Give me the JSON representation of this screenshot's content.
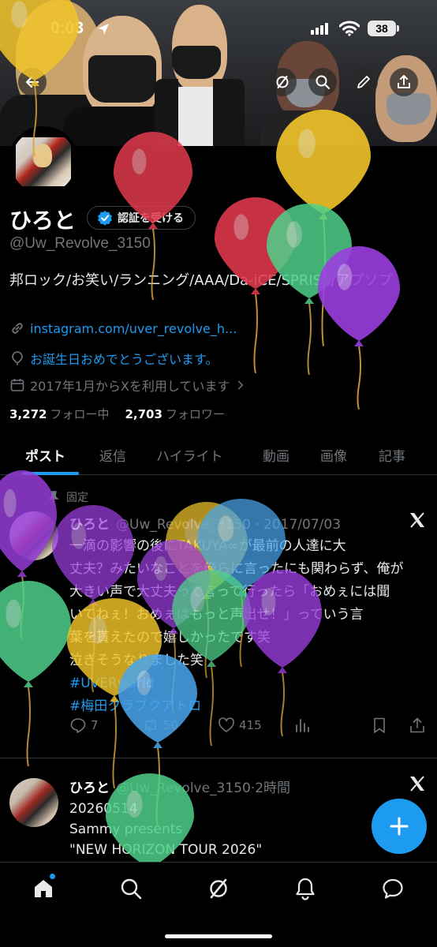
{
  "status_bar": {
    "time": "0:03",
    "battery": "38"
  },
  "profile": {
    "name": "ひろと",
    "verify_button": "認証を受ける",
    "handle": "@Uw_Revolve_3150",
    "bio": "邦ロック/お笑い/ランニング/AAA/Da-iCE/SPRISE/アプソプ",
    "link": "instagram.com/uver_revolve_h...",
    "birthday": "お誕生日おめでとうございます。",
    "joined": "2017年1月からXを利用しています",
    "following_count": "3,272",
    "following_label": "フォロー中",
    "followers_count": "2,703",
    "followers_label": "フォロワー"
  },
  "tabs": [
    {
      "label": "ポスト"
    },
    {
      "label": "返信"
    },
    {
      "label": "ハイライト"
    },
    {
      "label": "動画"
    },
    {
      "label": "画像"
    },
    {
      "label": "記事"
    }
  ],
  "posts": [
    {
      "pinned_label": "固定",
      "name": "ひろと",
      "handle": "@Uw_Revolve_3150",
      "date": "2017/07/03",
      "text_lines": [
        "一滴の影響の後にTAKUYA∞が最前の人達に大",
        "丈夫？みたいなことを俺らに言ったにも関わらず、俺が",
        "大きい声で大丈夫って言って行ったら「おめぇには聞",
        "いてねぇ！おめぇはもっと声出せ！」っていう言",
        "葉を貰えたので嬉しかったです笑",
        "泣きそうなりました笑"
      ],
      "hashtags": [
        "#UVERworld",
        "#梅田クラブクアトロ"
      ],
      "replies": "7",
      "reposts": "50",
      "likes": "415"
    },
    {
      "name": "ひろと",
      "handle": "@Uw_Revolve_3150",
      "time": "2時間",
      "text_lines": [
        "20260514",
        "Sammy presents",
        "\"NEW HORIZON TOUR 2026\""
      ]
    }
  ],
  "colors": {
    "accent": "#1d9bf0",
    "background": "#000000",
    "text": "#e7e9ea",
    "muted": "#71767b",
    "balloon_red": "#e23a4d",
    "balloon_yellow": "#f2c52a",
    "balloon_green": "#4fd18a",
    "balloon_purple": "#9b3fe0",
    "balloon_blue": "#4aa6ee"
  },
  "icons": [
    "back-arrow-icon",
    "grok-icon",
    "search-icon",
    "edit-icon",
    "share-icon",
    "verified-check-icon",
    "link-icon",
    "balloon-location-icon",
    "calendar-icon",
    "pin-icon",
    "x-logo-icon",
    "reply-icon",
    "repost-icon",
    "like-icon",
    "views-icon",
    "bookmark-icon",
    "compose-plus-icon",
    "home-icon",
    "notifications-icon",
    "messages-icon"
  ]
}
